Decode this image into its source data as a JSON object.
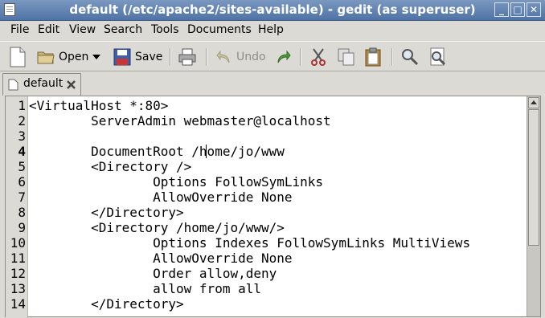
{
  "window": {
    "title": "default (/etc/apache2/sites-available) - gedit (as superuser)",
    "minimize_icon": "minimize-icon",
    "maximize_icon": "maximize-icon",
    "close_icon": "close-icon"
  },
  "menu": {
    "items": [
      "File",
      "Edit",
      "View",
      "Search",
      "Tools",
      "Documents",
      "Help"
    ]
  },
  "toolbar": {
    "open_label": "Open",
    "save_label": "Save",
    "undo_label": "Undo"
  },
  "tabs": [
    {
      "label": "default",
      "icon": "document-icon",
      "close_icon": "close-tab-icon"
    }
  ],
  "editor": {
    "line_numbers": [
      "1",
      "2",
      "3",
      "4",
      "5",
      "6",
      "7",
      "8",
      "9",
      "10",
      "11",
      "12",
      "13",
      "14"
    ],
    "current_line": "4",
    "lines": [
      "<VirtualHost *:80>",
      "        ServerAdmin webmaster@localhost",
      "",
      "        DocumentRoot /home/jo/www",
      "        <Directory />",
      "                Options FollowSymLinks",
      "                AllowOverride None",
      "        </Directory>",
      "        <Directory /home/jo/www/>",
      "                Options Indexes FollowSymLinks MultiViews",
      "                AllowOverride None",
      "                Order allow,deny",
      "                allow from all",
      "        </Directory>"
    ]
  },
  "colors": {
    "titlebar": "#5a7fb0",
    "chrome": "#dcdad5",
    "editor_bg": "#ffffff"
  }
}
